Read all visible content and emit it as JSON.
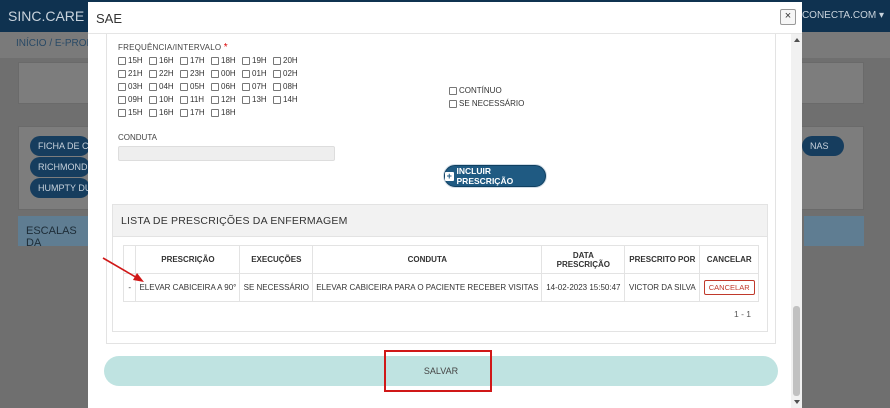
{
  "app": {
    "brand": "SINC.CARE Tecn",
    "user_menu": "NCONECTA.COM ▾",
    "breadcrumb": "INÍCIO  /  E-PRON"
  },
  "background": {
    "buttons": [
      "FICHA DE C",
      "RICHMOND",
      "HUMPTY DU"
    ],
    "nas_button": "NAS",
    "escalas_label": "ESCALAS DA"
  },
  "modal": {
    "title": "SAE",
    "close_label": "×"
  },
  "frequencia": {
    "label": "FREQUÊNCIA/INTERVALO",
    "required_mark": "*",
    "rows": [
      [
        "15H",
        "16H",
        "17H",
        "18H",
        "19H",
        "20H"
      ],
      [
        "21H",
        "22H",
        "23H",
        "00H",
        "01H",
        "02H"
      ],
      [
        "03H",
        "04H",
        "05H",
        "06H",
        "07H",
        "08H"
      ],
      [
        "09H",
        "10H",
        "11H",
        "12H",
        "13H",
        "14H"
      ],
      [
        "15H",
        "16H",
        "17H",
        "18H"
      ]
    ],
    "continuo_label": "CONTÍNUO",
    "se_necessario_label": "SE NECESSÁRIO"
  },
  "conduta": {
    "label": "CONDUTA",
    "value": ""
  },
  "incluir_button": "INCLUIR PRESCRIÇÃO",
  "lista": {
    "title": "LISTA DE PRESCRIÇÕES DA ENFERMAGEM",
    "columns": [
      "",
      "PRESCRIÇÃO",
      "EXECUÇÕES",
      "CONDUTA",
      "DATA PRESCRIÇÃO",
      "PRESCRITO POR",
      "CANCELAR"
    ],
    "rows": [
      {
        "marker": "-",
        "prescricao": "ELEVAR CABICEIRA A 90°",
        "execucoes": "SE NECESSÁRIO",
        "conduta": "ELEVAR CABICEIRA PARA O PACIENTE RECEBER VISITAS",
        "data": "14-02-2023 15:50:47",
        "prescrito_por": "VICTOR DA SILVA",
        "cancelar": "CANCELAR"
      }
    ],
    "pager": "1 - 1"
  },
  "save_button": "SALVAR",
  "colors": {
    "primary": "#1f5a82",
    "save_bar": "#bfe3e1",
    "annotation": "#d01818",
    "link": "#3a8fc7"
  }
}
